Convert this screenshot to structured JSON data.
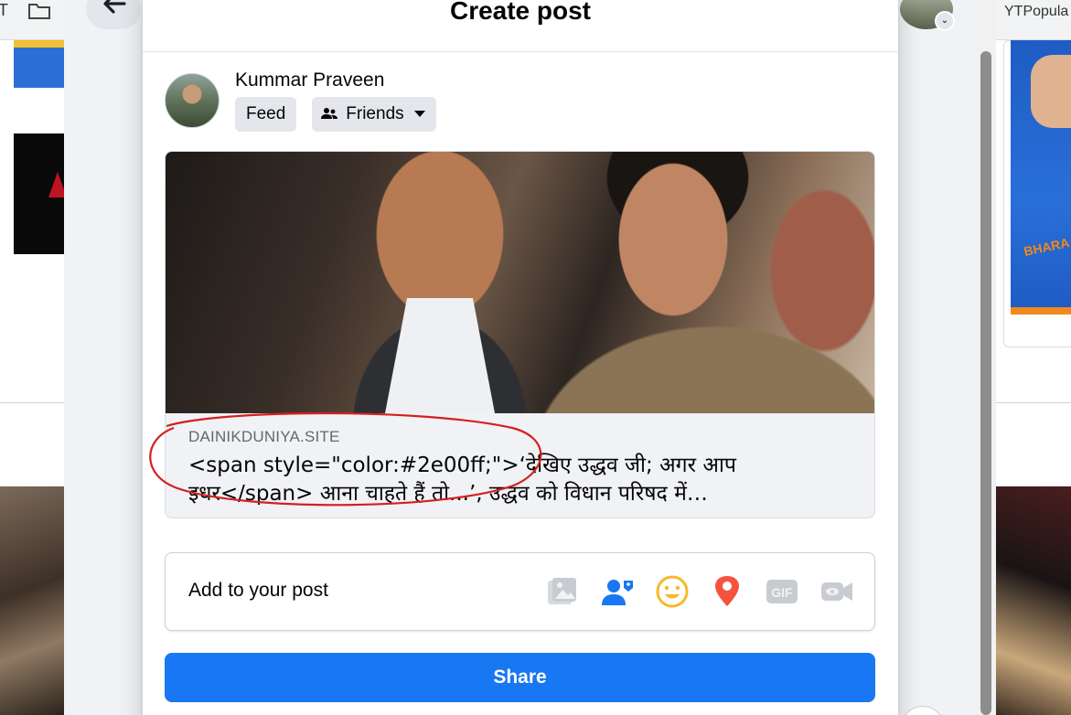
{
  "browser": {
    "left_tab_glyph": "T",
    "right_tab_label": "YTPopula"
  },
  "modal": {
    "title": "Create post",
    "author": {
      "name": "Kummar Praveen"
    },
    "audience": {
      "feed_label": "Feed",
      "friends_label": "Friends"
    },
    "link_preview": {
      "domain": "DAINIKDUNIYA.SITE",
      "title": "<span style=\"color:#2e00ff;\">‘देखिए उद्धव जी; अगर आप इधर</span> आना चाहते हैं तो...’, उद्धव को विधान परिषद में…"
    },
    "add_to_post": {
      "label": "Add to your post",
      "icons": [
        "photo-video-icon",
        "tag-people-icon",
        "feeling-activity-icon",
        "check-in-icon",
        "gif-icon",
        "live-video-icon"
      ]
    },
    "share_label": "Share"
  },
  "nav": {
    "icons": [
      "back-arrow-icon",
      "facebook-logo-icon",
      "menu-grid-icon",
      "messenger-icon",
      "notifications-icon",
      "account-avatar"
    ]
  },
  "background_ad": {
    "text": "BHARA"
  },
  "colors": {
    "primary": "#1877f2",
    "annotation_red": "#d51f1f",
    "secondary_bg": "#e4e6eb",
    "tag_people_blue": "#1877f2",
    "feeling_yellow": "#f7b928",
    "checkin_red": "#f5533d"
  }
}
